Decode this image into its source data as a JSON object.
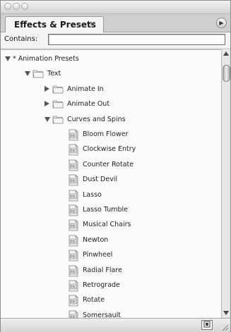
{
  "panel": {
    "tab_label": "Effects & Presets",
    "close_glyph": "×",
    "menu_glyph": "▶"
  },
  "search": {
    "label": "Contains:",
    "value": ""
  },
  "tree": [
    {
      "level": 0,
      "type": "root",
      "expanded": true,
      "label": "* Animation Presets"
    },
    {
      "level": 1,
      "type": "folder",
      "expanded": true,
      "label": "Text"
    },
    {
      "level": 2,
      "type": "folder",
      "expanded": false,
      "label": "Animate In"
    },
    {
      "level": 2,
      "type": "folder",
      "expanded": false,
      "label": "Animate Out"
    },
    {
      "level": 2,
      "type": "folder",
      "expanded": true,
      "label": "Curves and Spins"
    },
    {
      "level": 3,
      "type": "preset",
      "label": "Bloom Flower"
    },
    {
      "level": 3,
      "type": "preset",
      "label": "Clockwise Entry"
    },
    {
      "level": 3,
      "type": "preset",
      "label": "Counter Rotate"
    },
    {
      "level": 3,
      "type": "preset",
      "label": "Dust Devil"
    },
    {
      "level": 3,
      "type": "preset",
      "label": "Lasso"
    },
    {
      "level": 3,
      "type": "preset",
      "label": "Lasso Tumble"
    },
    {
      "level": 3,
      "type": "preset",
      "label": "Musical Chairs"
    },
    {
      "level": 3,
      "type": "preset",
      "label": "Newton"
    },
    {
      "level": 3,
      "type": "preset",
      "label": "Pinwheel"
    },
    {
      "level": 3,
      "type": "preset",
      "label": "Radial Flare"
    },
    {
      "level": 3,
      "type": "preset",
      "label": "Retrograde"
    },
    {
      "level": 3,
      "type": "preset",
      "label": "Rotate"
    },
    {
      "level": 3,
      "type": "preset",
      "label": "Somersault"
    }
  ],
  "icons": {
    "folder": "folder-icon",
    "preset": "animation-preset-file-icon",
    "expand": "disclosure-triangle-icon"
  },
  "colors": {
    "panel_bg": "#d9d9d9",
    "list_bg": "#fbfbfb",
    "text": "#1e1e1e"
  }
}
